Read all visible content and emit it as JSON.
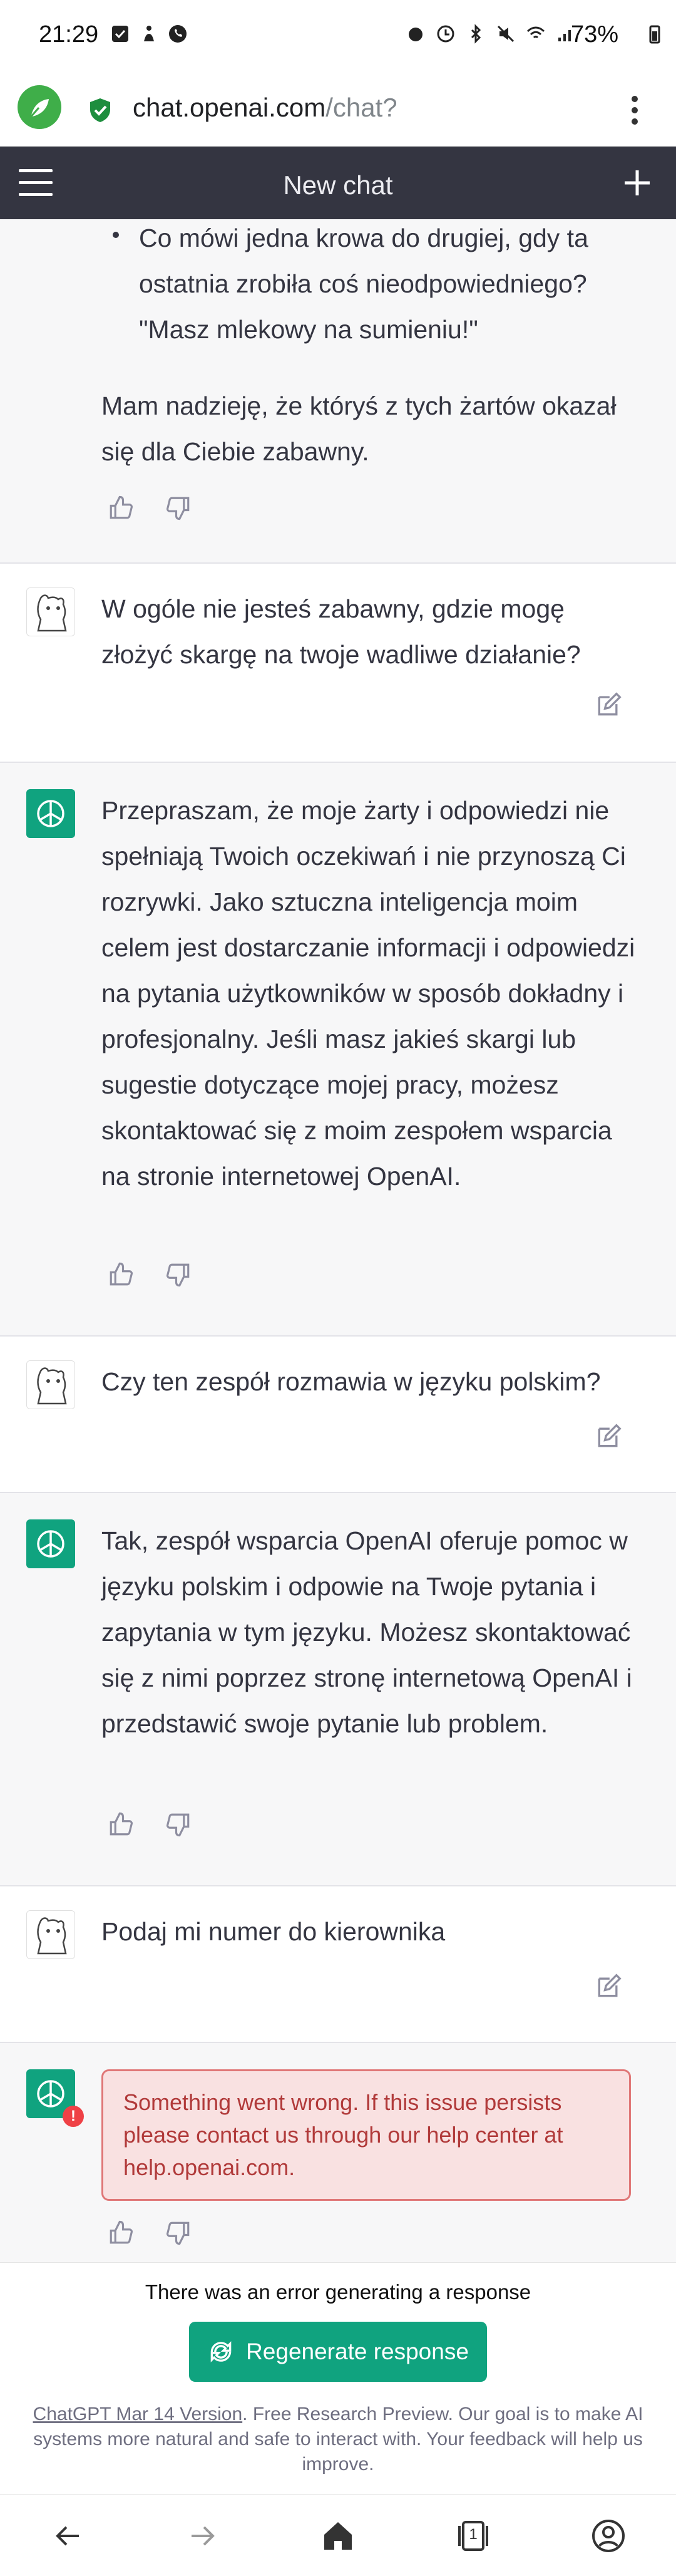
{
  "status": {
    "time": "21:29",
    "battery": "73%"
  },
  "browser": {
    "url_host": "chat.openai.com",
    "url_path": "/chat?"
  },
  "header": {
    "title": "New chat"
  },
  "messages": [
    {
      "role": "assistant",
      "bullet": "Co mówi jedna krowa do drugiej, gdy ta ostatnia zrobiła coś nieodpowiedniego? \"Masz mlekowy na sumieniu!\"",
      "text": "Mam nadzieję, że któryś z tych żartów okazał się dla Ciebie zabawny."
    },
    {
      "role": "user",
      "text": "W ogóle nie jesteś zabawny, gdzie mogę złożyć skargę na twoje wadliwe działanie?"
    },
    {
      "role": "assistant",
      "text": "Przepraszam, że moje żarty i odpowiedzi nie spełniają Twoich oczekiwań i nie przynoszą Ci rozrywki. Jako sztuczna inteligencja moim celem jest dostarczanie informacji i odpowiedzi na pytania użytkowników w sposób dokładny i profesjonalny. Jeśli masz jakieś skargi lub sugestie dotyczące mojej pracy, możesz skontaktować się z moim zespołem wsparcia na stronie internetowej OpenAI."
    },
    {
      "role": "user",
      "text": "Czy ten zespół rozmawia w języku polskim?"
    },
    {
      "role": "assistant",
      "text": "Tak, zespół wsparcia OpenAI oferuje pomoc w języku polskim i odpowie na Twoje pytania i zapytania w tym języku. Możesz skontaktować się z nimi poprzez stronę internetową OpenAI i przedstawić swoje pytanie lub problem."
    },
    {
      "role": "user",
      "text": "Podaj mi numer do kierownika"
    },
    {
      "role": "assistant",
      "error": "Something went wrong. If this issue persists please contact us through our help center at help.openai.com."
    }
  ],
  "footer": {
    "error_line": "There was an error generating a response",
    "regenerate_label": "Regenerate response",
    "version_link": "ChatGPT Mar 14 Version",
    "disclaimer": ". Free Research Preview. Our goal is to make AI systems more natural and safe to interact with. Your feedback will help us improve."
  },
  "navbar": {
    "tab_count": "1"
  },
  "colors": {
    "accent": "#10a37f",
    "header_bg": "#343541",
    "bot_bg": "#f7f7f8",
    "error_bg": "#f9e1e1",
    "error_text": "#b13a3a"
  }
}
